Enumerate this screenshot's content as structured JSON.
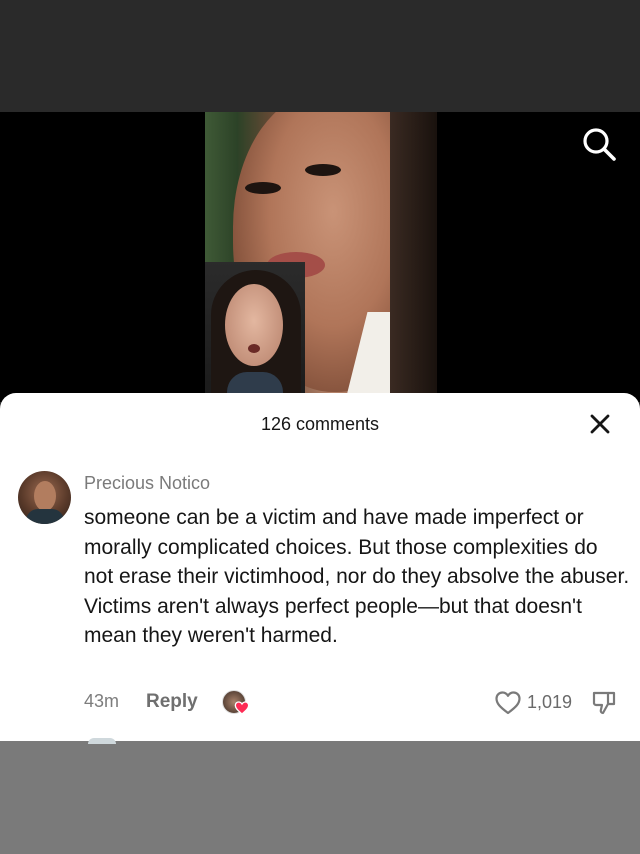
{
  "comments_header": {
    "count_label": "126 comments"
  },
  "comment": {
    "username": "Precious Notico",
    "text_paragraph_1": "someone can be a victim and have made imperfect or morally complicated choices. But those complexities do not erase their victimhood, nor do they absolve the abuser.",
    "text_paragraph_2": "Victims aren't always perfect people—but that doesn't mean they weren't harmed.",
    "time_ago": "43m",
    "reply_label": "Reply",
    "like_count": "1,019"
  },
  "icons": {
    "search": "search-icon",
    "close": "close-icon",
    "like": "heart-outline-icon",
    "dislike": "thumbs-down-icon",
    "creator_liked": "creator-liked-heart-icon"
  },
  "colors": {
    "accent_heart": "#fe2c55",
    "text_primary": "#161616",
    "text_secondary": "#7d7d7d"
  }
}
